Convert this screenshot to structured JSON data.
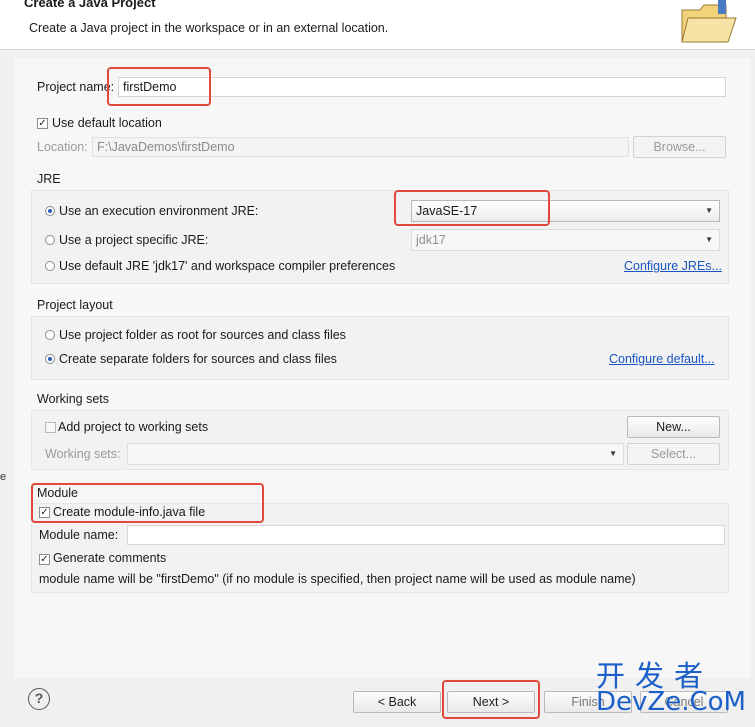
{
  "header": {
    "title": "Create a Java Project",
    "description": "Create a Java project in the workspace or in an external location."
  },
  "project": {
    "name_label": "Project name:",
    "name_value": "firstDemo",
    "use_default_location_label": "Use default location",
    "use_default_location_checked": true,
    "location_label": "Location:",
    "location_value": "F:\\JavaDemos\\firstDemo",
    "browse_label": "Browse..."
  },
  "jre": {
    "title": "JRE",
    "options": [
      {
        "label": "Use an execution environment JRE:",
        "selected": true,
        "value": "JavaSE-17"
      },
      {
        "label": "Use a project specific JRE:",
        "selected": false,
        "value": "jdk17"
      },
      {
        "label": "Use default JRE 'jdk17' and workspace compiler preferences",
        "selected": false
      }
    ],
    "configure_link": "Configure JREs..."
  },
  "layout": {
    "title": "Project layout",
    "options": [
      {
        "label": "Use project folder as root for sources and class files",
        "selected": false
      },
      {
        "label": "Create separate folders for sources and class files",
        "selected": true
      }
    ],
    "configure_link": "Configure default..."
  },
  "working_sets": {
    "title": "Working sets",
    "add_label": "Add project to working sets",
    "add_checked": false,
    "new_label": "New...",
    "field_label": "Working sets:",
    "select_label": "Select..."
  },
  "module": {
    "title": "Module",
    "create_label": "Create module-info.java file",
    "create_checked": true,
    "name_label": "Module name:",
    "name_value": "",
    "comments_label": "Generate comments",
    "comments_checked": true,
    "info_text": "module name will be \"firstDemo\"  (if no module is specified, then project name will be used as module name)"
  },
  "buttons": {
    "help": "?",
    "back": "< Back",
    "next": "Next >",
    "finish": "Finish",
    "cancel": "Cancel"
  },
  "watermark": {
    "cn": "开发者",
    "en": "DevZe.CoM"
  },
  "colors": {
    "highlight": "#e0493a",
    "link": "#1a55c2",
    "watermark": "#1c5fc9"
  }
}
